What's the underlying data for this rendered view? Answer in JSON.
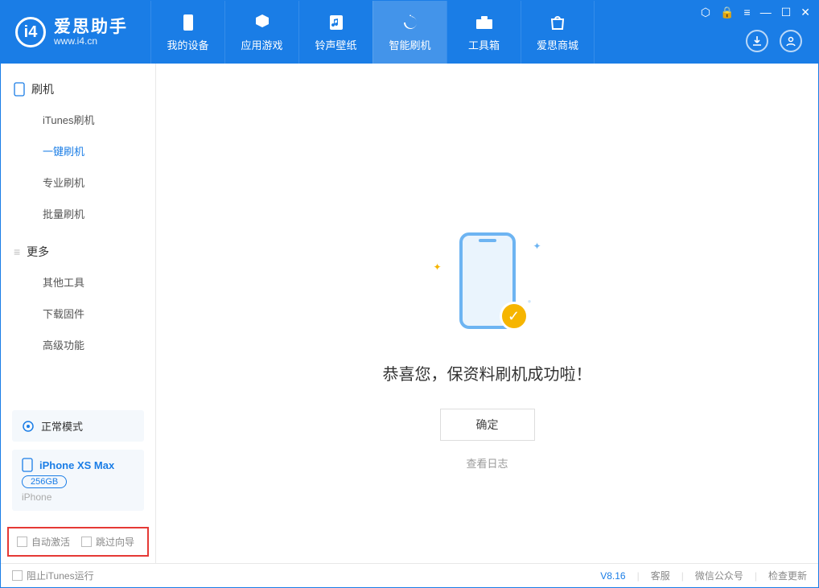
{
  "app": {
    "name": "爱思助手",
    "url": "www.i4.cn"
  },
  "nav": {
    "items": [
      {
        "label": "我的设备"
      },
      {
        "label": "应用游戏"
      },
      {
        "label": "铃声壁纸"
      },
      {
        "label": "智能刷机"
      },
      {
        "label": "工具箱"
      },
      {
        "label": "爱思商城"
      }
    ],
    "active_index": 3
  },
  "sidebar": {
    "group1": {
      "title": "刷机",
      "items": [
        {
          "label": "iTunes刷机"
        },
        {
          "label": "一键刷机"
        },
        {
          "label": "专业刷机"
        },
        {
          "label": "批量刷机"
        }
      ],
      "active_index": 1
    },
    "group2": {
      "title": "更多",
      "items": [
        {
          "label": "其他工具"
        },
        {
          "label": "下载固件"
        },
        {
          "label": "高级功能"
        }
      ]
    },
    "mode": "正常模式",
    "device": {
      "name": "iPhone XS Max",
      "capacity": "256GB",
      "type": "iPhone"
    },
    "checks": {
      "auto_activate": "自动激活",
      "skip_guide": "跳过向导"
    }
  },
  "main": {
    "success_msg": "恭喜您，保资料刷机成功啦！",
    "ok_btn": "确定",
    "log_link": "查看日志"
  },
  "status": {
    "block_itunes": "阻止iTunes运行",
    "version": "V8.16",
    "links": [
      "客服",
      "微信公众号",
      "检查更新"
    ]
  }
}
